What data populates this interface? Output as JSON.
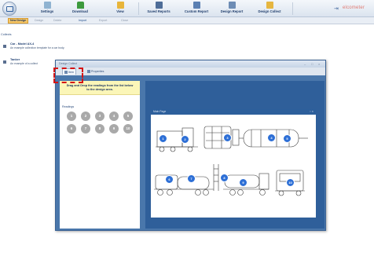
{
  "toolbar": {
    "buttons": [
      {
        "label": "Settings",
        "icon": "settings-icon",
        "color": "#7fa9c9"
      },
      {
        "label": "Download",
        "icon": "download-arrow-icon",
        "color": "#3d9a3d"
      },
      {
        "label": "View",
        "icon": "folder-view-icon",
        "color": "#e8b53a"
      },
      {
        "label": "Saved Reports",
        "icon": "saved-reports-icon",
        "color": "#4e6d98"
      },
      {
        "label": "Custom Report",
        "icon": "custom-report-icon",
        "color": "#5a7fb2"
      },
      {
        "label": "Design Report",
        "icon": "design-report-icon",
        "color": "#6d8cb5"
      },
      {
        "label": "Design Collect",
        "icon": "design-collect-icon",
        "color": "#e6b640"
      }
    ],
    "brand": "elcometer"
  },
  "subbar": {
    "items": [
      "New Design",
      "Design",
      "Delete",
      "Import",
      "Export",
      "Close"
    ]
  },
  "collects": {
    "header": "Collects",
    "items": [
      {
        "title": "Car - Model AX-4",
        "description": "An example collection template for a car body."
      },
      {
        "title": "Tanker",
        "description": "An example of a collect"
      }
    ]
  },
  "dialog": {
    "title": "Design Collect",
    "controls": [
      "–",
      "□",
      "×"
    ],
    "tabs": [
      "Item",
      "Properties"
    ],
    "instruction": "Drag and Drop the readings from the list below to the design area.",
    "readings_label": "Readings",
    "readings": [
      "1",
      "2",
      "3",
      "4",
      "5",
      "6",
      "7",
      "8",
      "9",
      "10"
    ],
    "page_title": "Main Page",
    "page_controls": "▫ ×",
    "markers": [
      "1",
      "2",
      "3",
      "4",
      "5",
      "6",
      "7",
      "8",
      "9",
      "10"
    ]
  }
}
